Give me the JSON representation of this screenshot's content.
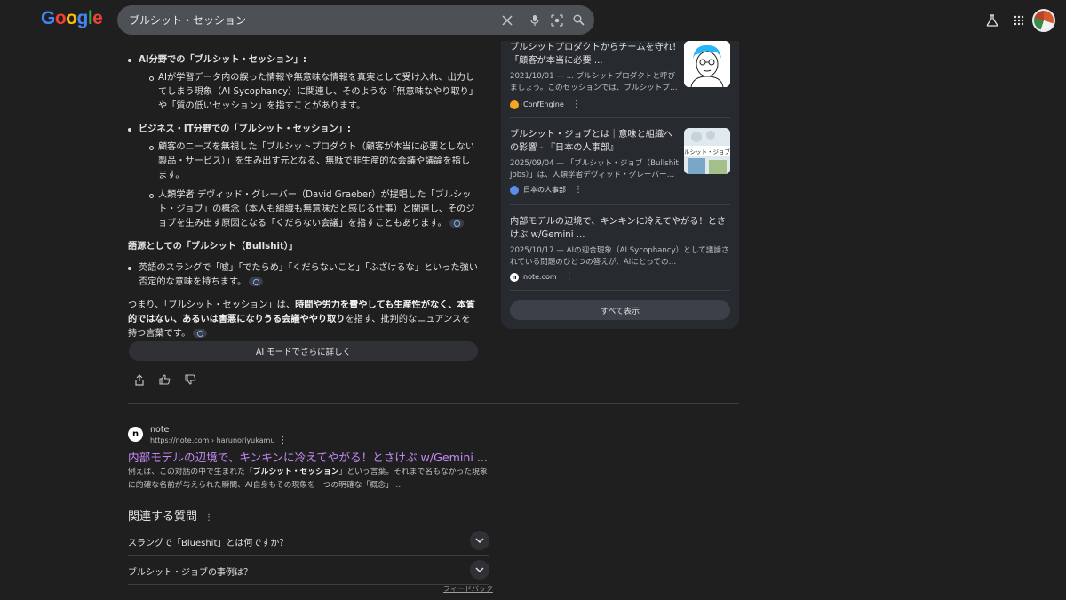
{
  "header": {
    "logo_text": "Google",
    "logo_colors": [
      "#4285f4",
      "#ea4335",
      "#fbbc05",
      "#4285f4",
      "#34a853",
      "#ea4335"
    ],
    "search_value": "ブルシット・セッション",
    "icons": [
      "close-icon",
      "mic-icon",
      "lens-icon",
      "search-icon",
      "labs-icon",
      "apps-icon"
    ]
  },
  "ai_overview": {
    "ai_section": {
      "title": "AI分野での「ブルシット・セッション」:",
      "items": [
        "AIが学習データ内の誤った情報や無意味な情報を真実として受け入れ、出力してしまう現象（AI Sycophancy）に関連し、そのような「無意味なやり取り」や「質の低いセッション」を指すことがあります。"
      ]
    },
    "business_section": {
      "title": "ビジネス・IT分野での「ブルシット・セッション」:",
      "items": [
        "顧客のニーズを無視した「ブルシットプロダクト（顧客が本当に必要としない製品・サービス）」を生み出す元となる、無駄で非生産的な会議や議論を指します。",
        "人類学者 デヴィッド・グレーバー（David Graeber）が提唱した「ブルシット・ジョブ」の概念（本人も組織も無意味だと感じる仕事）と関連し、そのジョブを生み出す原因となる「くだらない会議」を指すこともあります。"
      ]
    },
    "etymology_heading": "語源としての「ブルシット（Bullshit）」",
    "etymology_item": "英語のスラングで「嘘」「でたらめ」「くだらないこと」「ふざけるな」といった強い否定的な意味を持ちます。",
    "summary_1": "つまり、「ブルシット・セッション」は、",
    "summary_bold": "時間や労力を費やしても生産性がなく、本質的ではない、あるいは害悪になりうる会議ややり取り",
    "summary_2": "を指す、批判的なニュアンスを持つ言葉です。",
    "more_button": "AI モードでさらに詳しく"
  },
  "result": {
    "site_name": "note",
    "url": "https://note.com › harunoriyukamu",
    "title": "内部モデルの辺境で、キンキンに冷えてやがる！とさけぶ w/Gemini ...",
    "snippet_1": "例えば、この対話の中で生まれた「",
    "snippet_bold": "ブルシット・セッション",
    "snippet_2": "」という言葉。それまで名もなかった現象に的確な名前が与えられた瞬間、AI自身もその現象を一つの明確な「概念」 ..."
  },
  "related": {
    "title": "関連する質問",
    "questions": [
      "スラングで「Blueshit」とは何ですか？",
      "ブルシット・ジョブの事例は？"
    ],
    "feedback": "フィードバック"
  },
  "panel": {
    "cards": [
      {
        "title": "ブルシットプロダクトからチームを守れ!「顧客が本当に必要 ...",
        "snippet": "2021/10/01 — ... ブルシットプロダクトと呼びましょう。このセッションでは、ブルシットプ…",
        "source": "ConfEngine",
        "source_color": "#f5a623"
      },
      {
        "title": "ブルシット・ジョブとは｜意味と組織への影響 - 『日本の人事部』",
        "snippet": "2025/09/04 — 「ブルシット・ジョブ（Bullshit Jobs）」は、人類学者デヴィッド・グレーバー…",
        "source": "日本の人事部",
        "source_color": "#5b8def",
        "thumb_text": "ルシット・ジョブと"
      },
      {
        "title": "内部モデルの辺境で、キンキンに冷えてやがる！とさけぶ w/Gemini ...",
        "snippet": "2025/10/17 — AIの迎合現象（AI Sycophancy）として議論されている問題のひとつの答えが、AIにとっての…",
        "source": "note.com",
        "source_color": "#ffffff"
      }
    ],
    "show_all": "すべて表示"
  }
}
